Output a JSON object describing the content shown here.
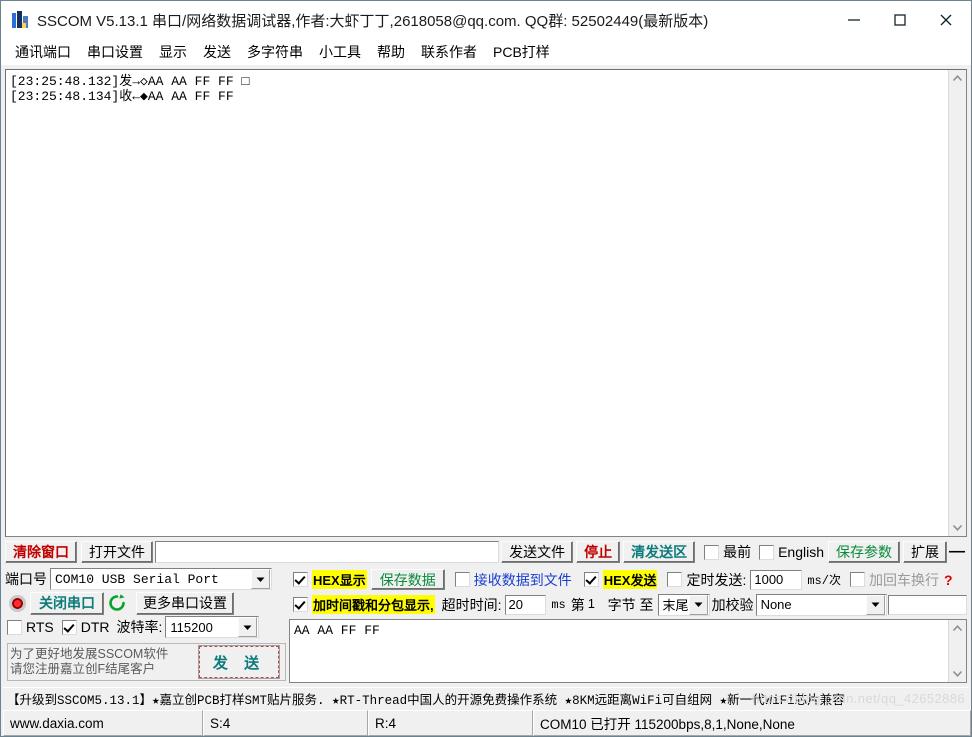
{
  "window": {
    "title": "SSCOM V5.13.1 串口/网络数据调试器,作者:大虾丁丁,2618058@qq.com. QQ群: 52502449(最新版本)",
    "icon": "app-icon",
    "minimize": "−",
    "maximize": "□",
    "close": "✕"
  },
  "menu": {
    "items": [
      {
        "label": "通讯端口"
      },
      {
        "label": "串口设置"
      },
      {
        "label": "显示"
      },
      {
        "label": "发送"
      },
      {
        "label": "多字符串"
      },
      {
        "label": "小工具"
      },
      {
        "label": "帮助"
      },
      {
        "label": "联系作者"
      },
      {
        "label": "PCB打样"
      }
    ]
  },
  "receive": {
    "content": "[23:25:48.132]发→◇AA AA FF FF □\n[23:25:48.134]收←◆AA AA FF FF"
  },
  "toolbar": {
    "clear_window": "清除窗口",
    "open_file": "打开文件",
    "file_path_value": "",
    "file_path_placeholder": "",
    "send_file": "发送文件",
    "stop": "停止",
    "clear_send": "清发送区",
    "topmost_label": "最前",
    "topmost_checked": false,
    "english_label": "English",
    "english_checked": false,
    "save_params": "保存参数",
    "extend": "扩展",
    "collapse": "—"
  },
  "port_settings": {
    "port_label": "端口号",
    "port_value": "COM10 USB Serial Port",
    "close_port_button": "关闭串口",
    "refresh_icon": "refresh-icon",
    "more_settings": "更多串口设置",
    "rts_label": "RTS",
    "rts_checked": false,
    "dtr_label": "DTR",
    "dtr_checked": true,
    "baud_label": "波特率:",
    "baud_value": "115200",
    "reg_note_line1": "为了更好地发展SSCOM软件",
    "reg_note_line2": "请您注册嘉立创F结尾客户",
    "send_button": "发 送"
  },
  "display_settings": {
    "hex_display_label": "HEX显示",
    "hex_display_checked": true,
    "save_data_button": "保存数据",
    "recv_to_file_label": "接收数据到文件",
    "recv_to_file_checked": false,
    "timestamp_label": "加时间戳和分包显示,",
    "timestamp_checked": true,
    "timeout_label": "超时时间:",
    "timeout_value": "20",
    "timeout_unit": "ms",
    "hex_send_label": "HEX发送",
    "hex_send_checked": true,
    "timed_send_label": "定时发送:",
    "timed_send_checked": false,
    "timed_send_value": "1000",
    "timed_send_unit": "ms/次",
    "crlf_label": "加回车换行",
    "crlf_checked": false,
    "byte_prefix": "第",
    "byte_start_value": "1",
    "byte_mid": "字节 至",
    "byte_end_value": "末尾",
    "checksum_label": "加校验",
    "checksum_value": "None",
    "checksum_extra_value": "",
    "help_icon": "?"
  },
  "send_area": {
    "content": "AA AA FF FF"
  },
  "ad_banner": {
    "text": "【升级到SSCOM5.13.1】★嘉立创PCB打样SMT贴片服务. ★RT-Thread中国人的开源免费操作系统 ★8KM远距离WiFi可自组网 ★新一代WiFi芯片兼容"
  },
  "status_bar": {
    "cells": [
      {
        "text": "www.daxia.com"
      },
      {
        "text": "S:4"
      },
      {
        "text": "R:4"
      },
      {
        "text": "COM10 已打开  115200bps,8,1,None,None"
      }
    ],
    "watermark": "https://blog.csdn.net/qq_42652886"
  },
  "colors": {
    "accent_red": "#c00000",
    "accent_teal": "#0d7b7b",
    "accent_green": "#0a8a3a",
    "accent_blue": "#1b3fd0",
    "highlight_yellow": "#ffff00"
  }
}
